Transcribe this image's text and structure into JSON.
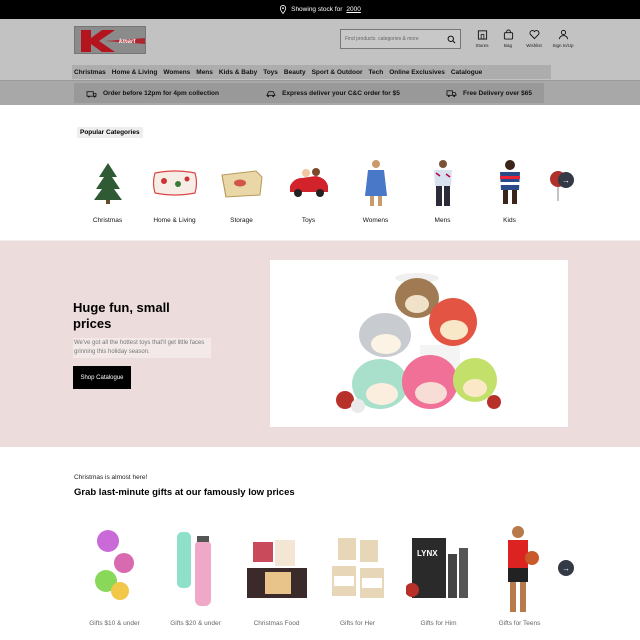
{
  "topbar": {
    "prefix": "Showing stock for",
    "postcode": "2000"
  },
  "header": {
    "logo_text": "kmart",
    "search_placeholder": "Find products, categories & more",
    "icons": [
      {
        "icon": "store-icon",
        "label": "Stores"
      },
      {
        "icon": "bag-icon",
        "label": "Bag"
      },
      {
        "icon": "heart-icon",
        "label": "Wishlist"
      },
      {
        "icon": "user-icon",
        "label": "Sign In/Up"
      }
    ]
  },
  "nav": [
    "Christmas",
    "Home & Living",
    "Womens",
    "Mens",
    "Kids & Baby",
    "Toys",
    "Beauty",
    "Sport & Outdoor",
    "Tech",
    "Online Exclusives",
    "Catalogue"
  ],
  "promo": [
    {
      "icon": "click-collect-icon",
      "text": "Order before 12pm for 4pm collection"
    },
    {
      "icon": "express-icon",
      "text": "Express deliver your C&C order for $5"
    },
    {
      "icon": "truck-icon",
      "text": "Free Delivery over $65"
    }
  ],
  "categories": {
    "heading": "Popular Categories",
    "items": [
      "Christmas",
      "Home & Living",
      "Storage",
      "Toys",
      "Womens",
      "Mens",
      "Kids"
    ]
  },
  "hero": {
    "title": "Huge fun, small prices",
    "body": "We've got all the hottest toys that'll get little faces grinning this holiday season.",
    "button": "Shop Catalogue"
  },
  "gifts": {
    "eyebrow": "Christmas is almost here!",
    "title": "Grab last-minute gifts at our famously low prices",
    "items": [
      "Gifts $10 & under",
      "Gifts $20 & under",
      "Christmas Food",
      "Gifts for Her",
      "Gifts for Him",
      "Gifts for Teens"
    ]
  },
  "colors": {
    "topbar": "#000000",
    "header": "#c2c2c2",
    "hero_bg": "#eddcdc",
    "arrow": "#333a45",
    "logo_red": "#b4141e"
  }
}
